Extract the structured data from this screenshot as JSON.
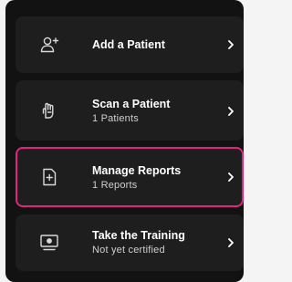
{
  "colors": {
    "background": "#121212",
    "card": "#1e1e1e",
    "highlight": "#e0267c",
    "text": "#ffffff",
    "subtext": "#cfcfcf"
  },
  "menu": {
    "items": [
      {
        "title": "Add a Patient",
        "subtitle": "",
        "icon": "add-user-icon"
      },
      {
        "title": "Scan a Patient",
        "subtitle": "1 Patients",
        "icon": "hand-scan-icon"
      },
      {
        "title": "Manage Reports",
        "subtitle": "1 Reports",
        "icon": "document-plus-icon",
        "selected": true
      },
      {
        "title": "Take the Training",
        "subtitle": "Not yet certified",
        "icon": "monitor-icon"
      }
    ]
  }
}
